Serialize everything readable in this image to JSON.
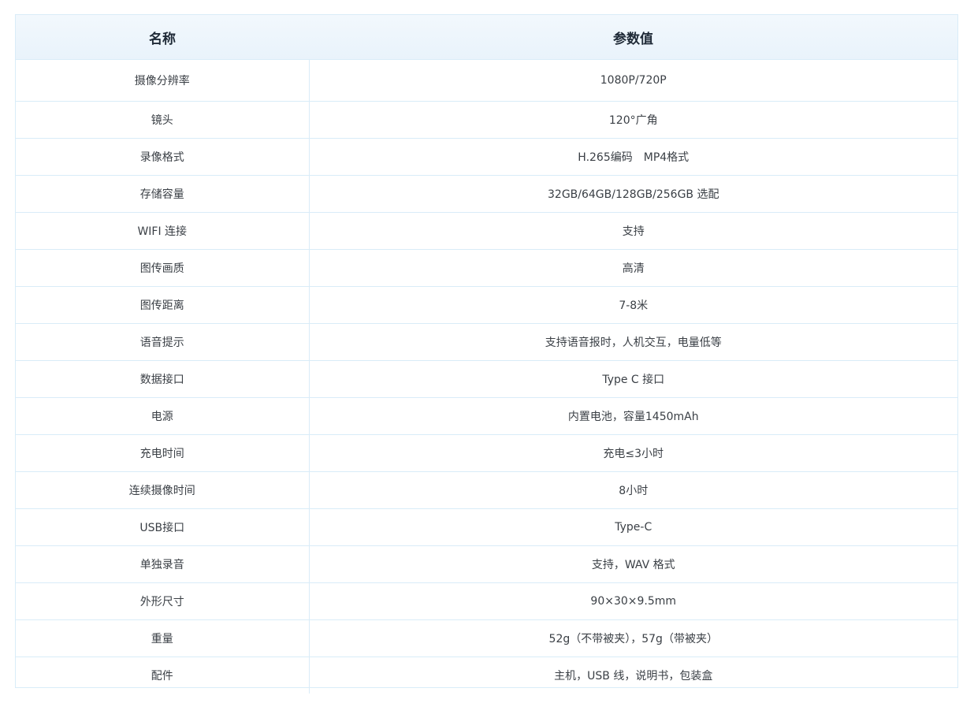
{
  "table": {
    "headers": [
      "名称",
      "参数值"
    ],
    "rows": [
      {
        "name": "摄像分辨率",
        "value": "1080P/720P"
      },
      {
        "name": "镜头",
        "value": "120°广角"
      },
      {
        "name": "录像格式",
        "value": "H.265编码　MP4格式"
      },
      {
        "name": "存储容量",
        "value": "32GB/64GB/128GB/256GB  选配"
      },
      {
        "name": "WIFI 连接",
        "value": "支持"
      },
      {
        "name": "图传画质",
        "value": "高清"
      },
      {
        "name": "图传距离",
        "value": "7-8米"
      },
      {
        "name": "语音提示",
        "value": "支持语音报时，人机交互，电量低等"
      },
      {
        "name": "数据接口",
        "value": "Type C 接口"
      },
      {
        "name": "电源",
        "value": "内置电池，容量1450mAh"
      },
      {
        "name": "充电时间",
        "value": "充电≤3小时"
      },
      {
        "name": "连续摄像时间",
        "value": "8小时"
      },
      {
        "name": "USB接口",
        "value": "Type-C"
      },
      {
        "name": "单独录音",
        "value": "支持，WAV 格式"
      },
      {
        "name": "外形尺寸",
        "value": "90×30×9.5mm"
      },
      {
        "name": "重量",
        "value": "52g（不带被夹），57g（带被夹）"
      },
      {
        "name": "配件",
        "value": "主机，USB 线，说明书，包装盒"
      }
    ]
  }
}
